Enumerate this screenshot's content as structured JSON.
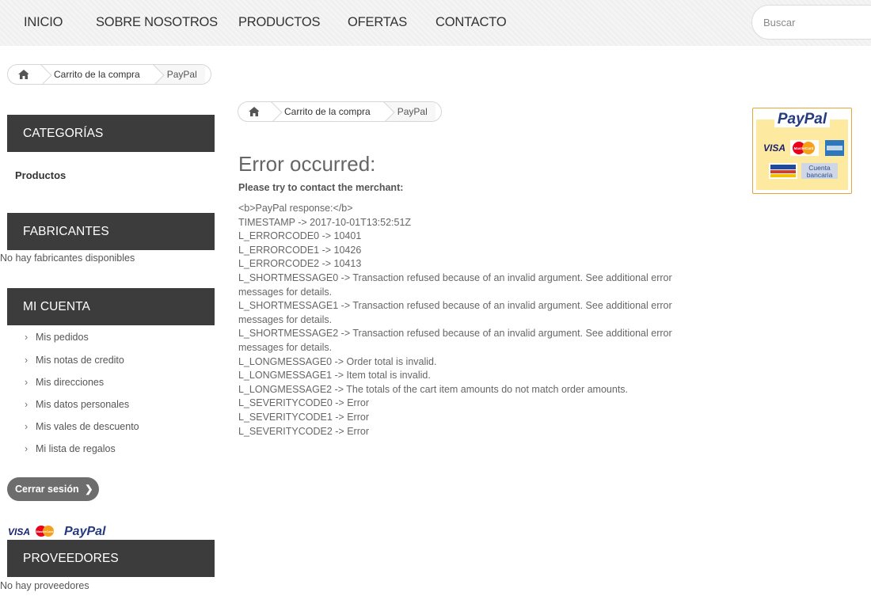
{
  "nav": {
    "items": [
      "INICIO",
      "SOBRE NOSOTROS",
      "PRODUCTOS",
      "OFERTAS",
      "CONTACTO"
    ],
    "search_placeholder": "Buscar"
  },
  "breadcrumb": {
    "cart": "Carrito de la compra",
    "current": "PayPal"
  },
  "sidebar": {
    "categories_title": "CATEGORÍAS",
    "categories_item": "Productos",
    "manufacturers_title": "FABRICANTES",
    "manufacturers_empty": "No hay fabricantes disponibles",
    "account_title": "MI CUENTA",
    "account_items": [
      "Mis pedidos",
      "Mis notas de credito",
      "Mis direcciones",
      "Mis datos personales",
      "Mis vales de descuento",
      "Mi lista de regalos"
    ],
    "logout_label": "Cerrar sesión",
    "suppliers_title": "PROVEEDORES",
    "suppliers_empty": "No hay proveedores"
  },
  "payment_logos": {
    "visa": "VISA",
    "mastercard": "MasterCard",
    "paypal": "PayPal"
  },
  "paypal_badge": {
    "title": "PayPal",
    "visa": "VISA",
    "mastercard": "MasterCard",
    "bank_line1": "Cuenta",
    "bank_line2": "bancaria"
  },
  "error": {
    "title": "Error occurred:",
    "subtitle": "Please try to contact the merchant:",
    "lines": [
      "<b>PayPal response:</b>",
      "TIMESTAMP -> 2017-10-01T13:52:51Z",
      "L_ERRORCODE0 -> 10401",
      "L_ERRORCODE1 -> 10426",
      "L_ERRORCODE2 -> 10413",
      "L_SHORTMESSAGE0 -> Transaction refused because of an invalid argument. See additional error messages for details.",
      "L_SHORTMESSAGE1 -> Transaction refused because of an invalid argument. See additional error messages for details.",
      "L_SHORTMESSAGE2 -> Transaction refused because of an invalid argument. See additional error messages for details.",
      "L_LONGMESSAGE0 -> Order total is invalid.",
      "L_LONGMESSAGE1 -> Item total is invalid.",
      "L_LONGMESSAGE2 -> The totals of the cart item amounts do not match order amounts.",
      "L_SEVERITYCODE0 -> Error",
      "L_SEVERITYCODE1 -> Error",
      "L_SEVERITYCODE2 -> Error"
    ]
  },
  "colors": {
    "sidebar_header": "#3c3c3c",
    "logout_button": "#6d6d6d",
    "paypal_dark": "#253b80",
    "paypal_light": "#179bd7",
    "badge_border": "#e8a63a"
  }
}
